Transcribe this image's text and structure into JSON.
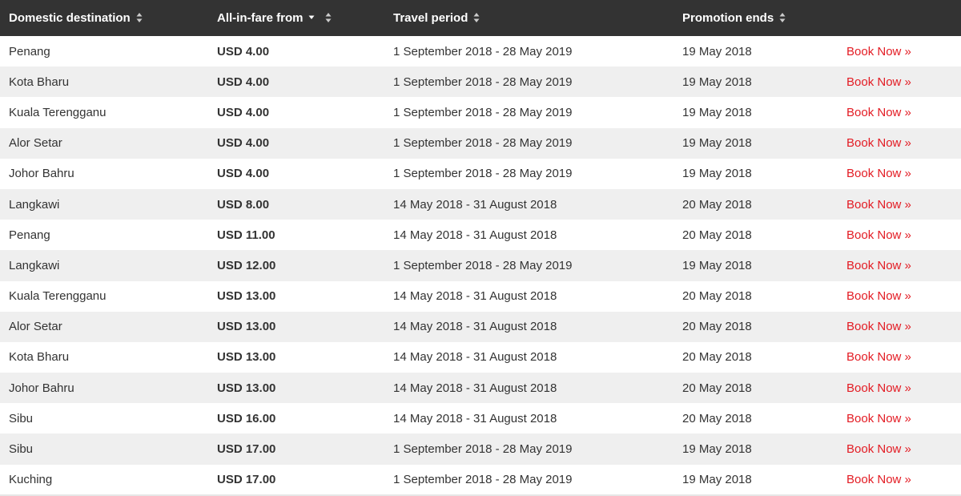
{
  "columns": {
    "destination": "Domestic destination",
    "fare": "All-in-fare from",
    "period": "Travel period",
    "ends": "Promotion ends"
  },
  "icons": {
    "sort_both": "sort-both-icon",
    "sort_desc": "sort-desc-icon"
  },
  "colors": {
    "header_bg": "#333333",
    "row_alt_bg": "#efefef",
    "link": "#e31b23"
  },
  "rows": [
    {
      "destination": "Penang",
      "fare": "USD 4.00",
      "period": "1 September 2018 - 28 May 2019",
      "ends": "19 May 2018",
      "action": "Book Now »"
    },
    {
      "destination": "Kota Bharu",
      "fare": "USD 4.00",
      "period": "1 September 2018 - 28 May 2019",
      "ends": "19 May 2018",
      "action": "Book Now »"
    },
    {
      "destination": "Kuala Terengganu",
      "fare": "USD 4.00",
      "period": "1 September 2018 - 28 May 2019",
      "ends": "19 May 2018",
      "action": "Book Now »"
    },
    {
      "destination": "Alor Setar",
      "fare": "USD 4.00",
      "period": "1 September 2018 - 28 May 2019",
      "ends": "19 May 2018",
      "action": "Book Now »"
    },
    {
      "destination": "Johor Bahru",
      "fare": "USD 4.00",
      "period": "1 September 2018 - 28 May 2019",
      "ends": "19 May 2018",
      "action": "Book Now »"
    },
    {
      "destination": "Langkawi",
      "fare": "USD 8.00",
      "period": "14 May 2018 - 31 August 2018",
      "ends": "20 May 2018",
      "action": "Book Now »"
    },
    {
      "destination": "Penang",
      "fare": "USD 11.00",
      "period": "14 May 2018 - 31 August 2018",
      "ends": "20 May 2018",
      "action": "Book Now »"
    },
    {
      "destination": "Langkawi",
      "fare": "USD 12.00",
      "period": "1 September 2018 - 28 May 2019",
      "ends": "19 May 2018",
      "action": "Book Now »"
    },
    {
      "destination": "Kuala Terengganu",
      "fare": "USD 13.00",
      "period": "14 May 2018 - 31 August 2018",
      "ends": "20 May 2018",
      "action": "Book Now »"
    },
    {
      "destination": "Alor Setar",
      "fare": "USD 13.00",
      "period": "14 May 2018 - 31 August 2018",
      "ends": "20 May 2018",
      "action": "Book Now »"
    },
    {
      "destination": "Kota Bharu",
      "fare": "USD 13.00",
      "period": "14 May 2018 - 31 August 2018",
      "ends": "20 May 2018",
      "action": "Book Now »"
    },
    {
      "destination": "Johor Bahru",
      "fare": "USD 13.00",
      "period": "14 May 2018 - 31 August 2018",
      "ends": "20 May 2018",
      "action": "Book Now »"
    },
    {
      "destination": "Sibu",
      "fare": "USD 16.00",
      "period": "14 May 2018 - 31 August 2018",
      "ends": "20 May 2018",
      "action": "Book Now »"
    },
    {
      "destination": "Sibu",
      "fare": "USD 17.00",
      "period": "1 September 2018 - 28 May 2019",
      "ends": "19 May 2018",
      "action": "Book Now »"
    },
    {
      "destination": "Kuching",
      "fare": "USD 17.00",
      "period": "1 September 2018 - 28 May 2019",
      "ends": "19 May 2018",
      "action": "Book Now »"
    }
  ]
}
